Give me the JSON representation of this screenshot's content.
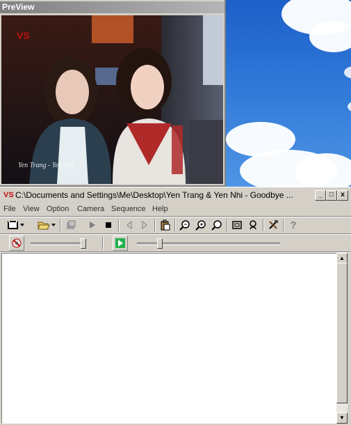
{
  "preview": {
    "title": "PreView",
    "caption": "Yen Trang - Yen Nhi"
  },
  "main": {
    "title": "C:\\Documents and Settings\\Me\\Desktop\\Yen Trang & Yen Nhi - Goodbye ...",
    "window_buttons": {
      "minimize": "_",
      "maximize": "□",
      "close": "x"
    },
    "menu": [
      {
        "label": "File"
      },
      {
        "label": "View"
      },
      {
        "label": "Option"
      },
      {
        "label": "Camera"
      },
      {
        "label": "Sequence"
      },
      {
        "label": "Help"
      }
    ]
  },
  "icons": {
    "app": "film-icon",
    "toolbar": [
      "film-strip-icon",
      "open-folder-icon",
      "save-icon",
      "play-icon",
      "stop-icon",
      "prev-frame-icon",
      "next-frame-icon",
      "paste-icon",
      "zoom-out-icon",
      "zoom-in-icon",
      "zoom-fit-icon",
      "frame-icon",
      "camera-settings-icon",
      "tools-icon",
      "help-icon"
    ],
    "second_toolbar": [
      "capture-icon",
      "play-green-icon"
    ]
  },
  "colors": {
    "accent_green": "#22b14c",
    "app_icon_red": "#c01010"
  }
}
